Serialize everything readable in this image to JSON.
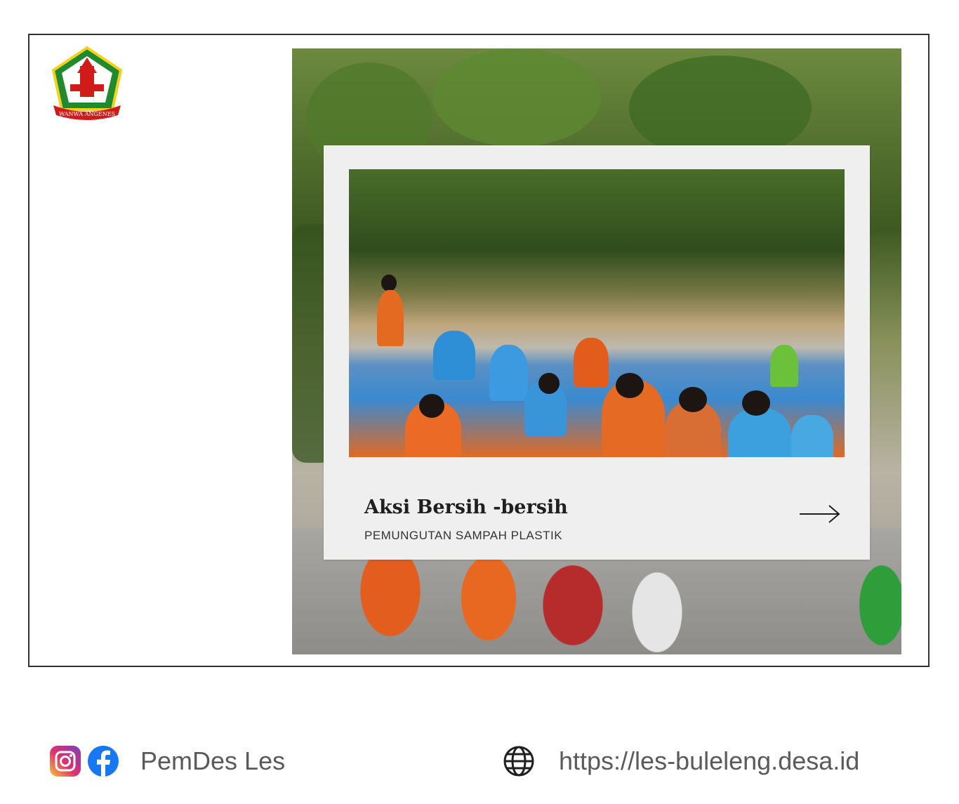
{
  "logo": {
    "icon": "village-emblem-icon",
    "ribbon_text": "WANWA ANGENES"
  },
  "card": {
    "title": "Aksi Bersih -bersih",
    "subtitle": "PEMUNGUTAN SAMPAH PLASTIK",
    "arrow_icon": "arrow-right-icon"
  },
  "footer": {
    "social_icons": [
      "instagram-icon",
      "facebook-icon"
    ],
    "social_name": "PemDes Les",
    "web_icon": "globe-icon",
    "website": "https://les-buleleng.desa.id"
  },
  "colors": {
    "card_bg": "#efefef",
    "footer_text": "#5a5a5a",
    "border": "#333333"
  }
}
